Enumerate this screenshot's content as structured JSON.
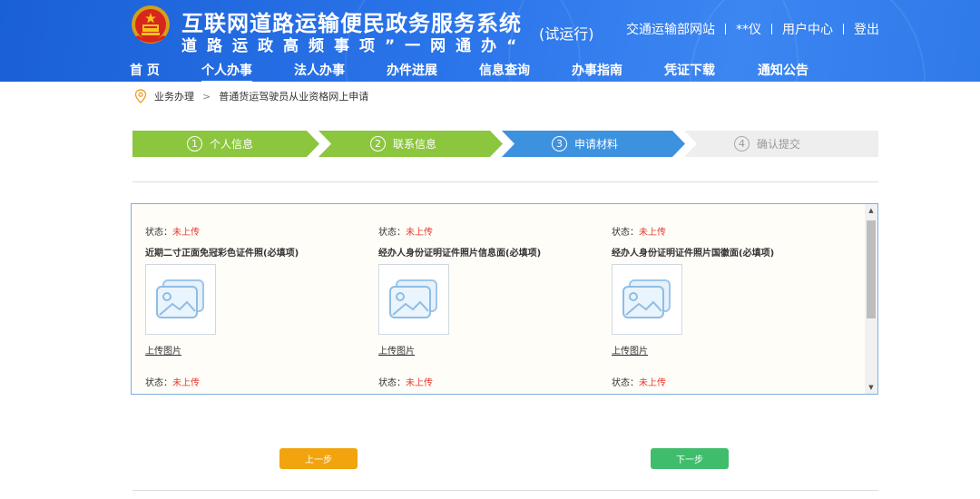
{
  "header": {
    "title": "互联网道路运输便民政务服务系统",
    "subtitle": "道路运政高频事项”一网通办“",
    "trial": "(试运行)",
    "links": {
      "ministry": "交通运输部网站",
      "user_name": "**仪",
      "user_center": "用户中心",
      "logout": "登出"
    },
    "colors": {
      "bar": "#2a74ea",
      "accent_red": "#e63a2f"
    }
  },
  "nav": [
    {
      "label": "首 页",
      "active": false
    },
    {
      "label": "个人办事",
      "active": true
    },
    {
      "label": "法人办事",
      "active": false
    },
    {
      "label": "办件进展",
      "active": false
    },
    {
      "label": "信息查询",
      "active": false
    },
    {
      "label": "办事指南",
      "active": false
    },
    {
      "label": "凭证下载",
      "active": false
    },
    {
      "label": "通知公告",
      "active": false
    }
  ],
  "breadcrumb": {
    "icon": "location-pin-icon",
    "home": "业务办理",
    "separator": ">",
    "current": "普通货运驾驶员从业资格网上申请"
  },
  "steps": [
    {
      "num": "1",
      "label": "个人信息",
      "state": "done",
      "color": "#8cc63e"
    },
    {
      "num": "2",
      "label": "联系信息",
      "state": "done",
      "color": "#8cc63e"
    },
    {
      "num": "3",
      "label": "申请材料",
      "state": "current",
      "color": "#3d92df"
    },
    {
      "num": "4",
      "label": "确认提交",
      "state": "todo",
      "color": "#eeeeee"
    }
  ],
  "uploads": {
    "status_label": "状态：",
    "status_value": "未上传",
    "upload_label": "上传图片",
    "items": [
      {
        "title": "近期二寸正面免冠彩色证件照(必填项)"
      },
      {
        "title": "经办人身份证明证件照片信息面(必填项)"
      },
      {
        "title": "经办人身份证明证件照片国徽面(必填项)"
      }
    ]
  },
  "buttons": {
    "prev": {
      "label": "上一步",
      "color": "#f1a40e"
    },
    "next": {
      "label": "下一步",
      "color": "#3fbd6c"
    }
  }
}
